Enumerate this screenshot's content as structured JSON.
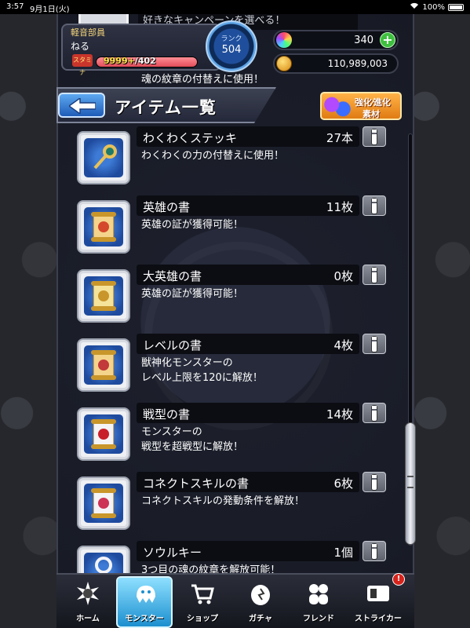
{
  "status_bar": {
    "time": "3:57",
    "date": "9月1日(火)",
    "battery": "100%"
  },
  "peek": {
    "name": "好きなキャンペーンを選べる！",
    "desc": "魂の紋章の付替えに使用！"
  },
  "player": {
    "title": "軽音部員",
    "name": "ねる",
    "stamina_label": "スタミナ",
    "stamina_current": "9999+",
    "stamina_max": "/402",
    "stamina_fill_fraction": 1.0,
    "rank_label": "ランク",
    "rank_value": "504"
  },
  "currency": {
    "orbs": "340",
    "gold": "110,989,003"
  },
  "header": {
    "title": "アイテム一覧",
    "evo_line1": "強化",
    "evo_line1b": "進化",
    "evo_line2": "素材"
  },
  "items": [
    {
      "name": "わくわくステッキ",
      "count": "27本",
      "desc": "わくわくの力の付替えに使用！",
      "icon": "wand-icon",
      "color": "#1f7a6a"
    },
    {
      "name": "英雄の書",
      "count": "11枚",
      "desc": "英雄の証が獲得可能！",
      "icon": "scroll-icon",
      "color": "#d4482c"
    },
    {
      "name": "大英雄の書",
      "count": "0枚",
      "desc": "英雄の証が獲得可能！",
      "icon": "gold-scroll-icon",
      "color": "#c9962b"
    },
    {
      "name": "レベルの書",
      "count": "4枚",
      "desc": "獣神化モンスターの\nレベル上限を120に解放！",
      "icon": "red-scroll-icon",
      "color": "#c23a3a"
    },
    {
      "name": "戦型の書",
      "count": "14枚",
      "desc": "モンスターの\n戦型を超戦型に解放！",
      "icon": "white-scroll-icon",
      "color": "#c8202a"
    },
    {
      "name": "コネクトスキルの書",
      "count": "6枚",
      "desc": "コネクトスキルの発動条件を解放！",
      "icon": "connect-scroll-icon",
      "color": "#cc3355"
    },
    {
      "name": "ソウルキー",
      "count": "1個",
      "desc": "3つ目の魂の紋章を解放可能！",
      "icon": "key-icon",
      "color": "#e8e8f0"
    }
  ],
  "nav": {
    "home": "ホーム",
    "monster": "モンスター",
    "shop": "ショップ",
    "gacha": "ガチャ",
    "friend": "フレンド",
    "striker": "ストライカー",
    "badge": "!"
  }
}
